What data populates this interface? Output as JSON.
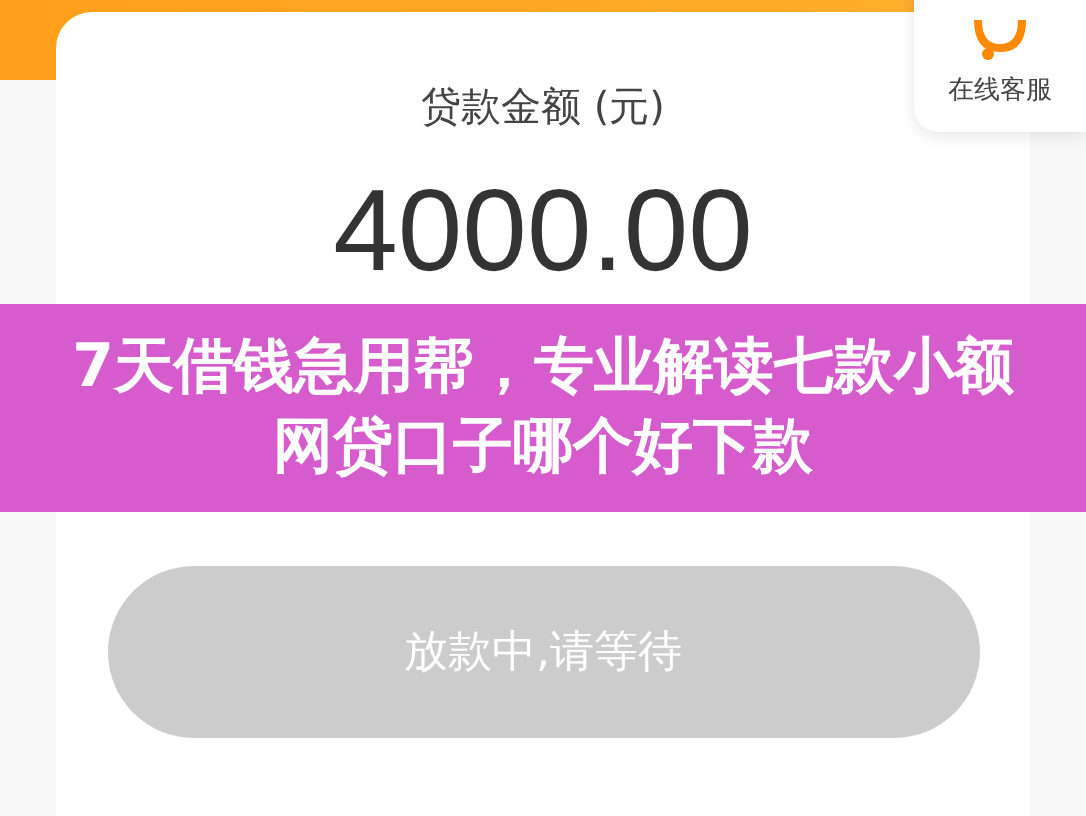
{
  "loan_card": {
    "amount_label": "贷款金额 (元)",
    "amount": "4000.00",
    "status_button": {
      "label": "放款中,请等待",
      "disabled": true
    }
  },
  "customer_service": {
    "label": "在线客服"
  },
  "overlay_banner": {
    "title": "7天借钱急用帮，专业解读七款小额网贷口子哪个好下款"
  }
}
